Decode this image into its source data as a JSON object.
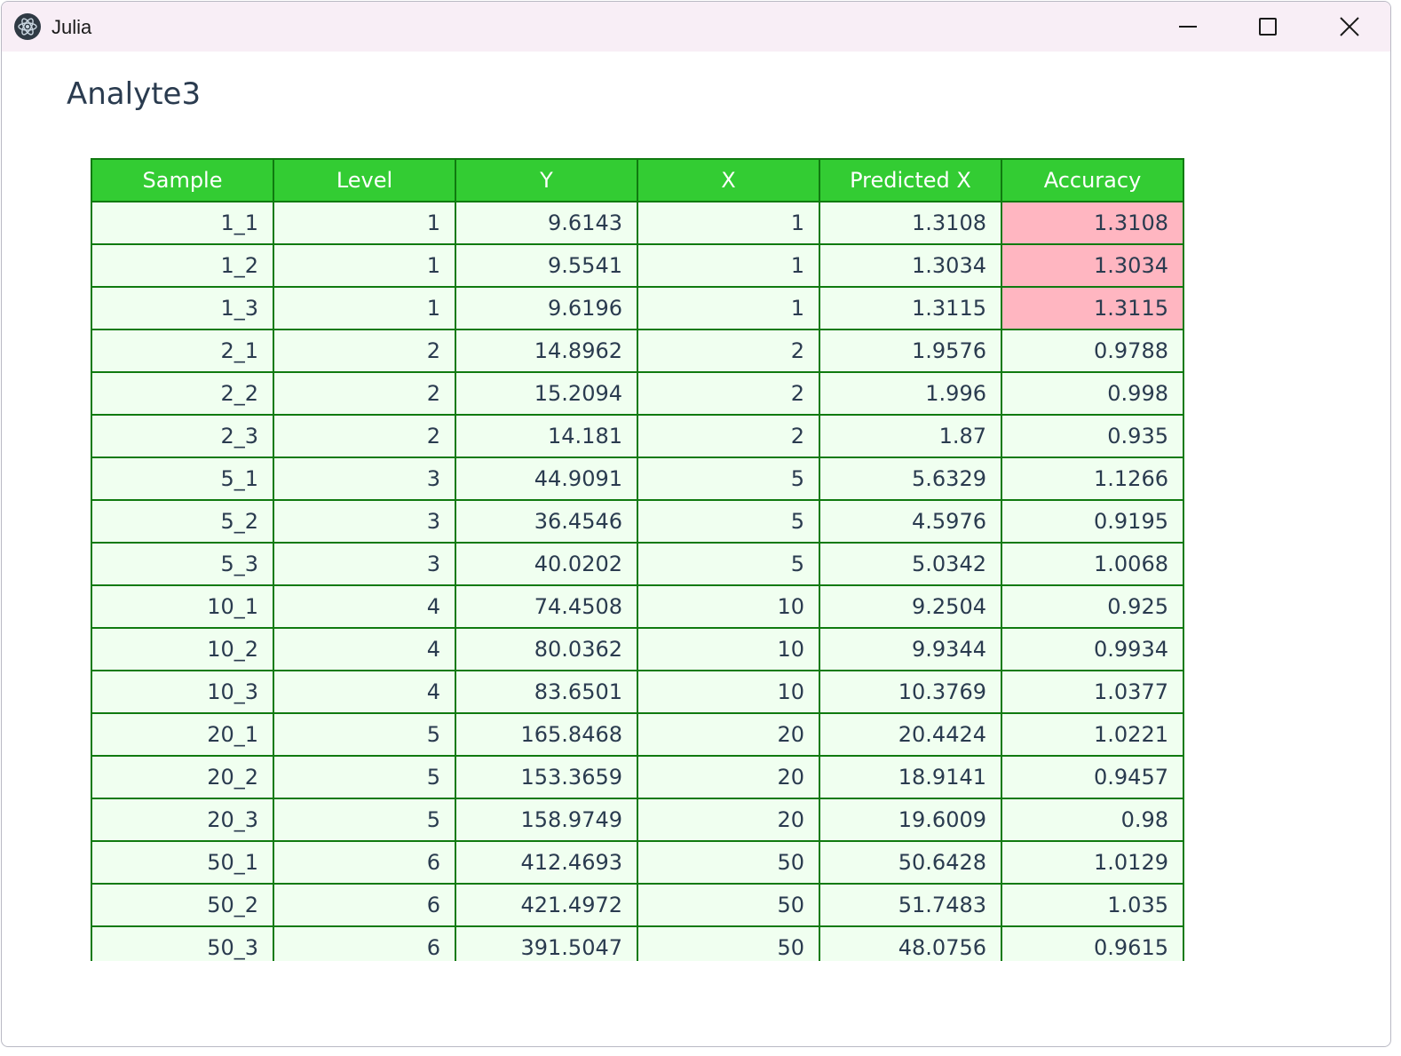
{
  "window": {
    "title": "Julia",
    "icons": {
      "app": "electron-logo-icon",
      "minimize": "minimize-icon",
      "maximize": "maximize-icon",
      "close": "close-icon"
    }
  },
  "page": {
    "heading": "Analyte3"
  },
  "table": {
    "headers": [
      "Sample",
      "Level",
      "Y",
      "X",
      "Predicted X",
      "Accuracy"
    ],
    "highlight_color": "#ffb6c1",
    "header_color": "#33cc33",
    "rows": [
      {
        "cells": [
          "1_1",
          "1",
          "9.6143",
          "1",
          "1.3108",
          "1.3108"
        ],
        "flagged": true
      },
      {
        "cells": [
          "1_2",
          "1",
          "9.5541",
          "1",
          "1.3034",
          "1.3034"
        ],
        "flagged": true
      },
      {
        "cells": [
          "1_3",
          "1",
          "9.6196",
          "1",
          "1.3115",
          "1.3115"
        ],
        "flagged": true
      },
      {
        "cells": [
          "2_1",
          "2",
          "14.8962",
          "2",
          "1.9576",
          "0.9788"
        ],
        "flagged": false
      },
      {
        "cells": [
          "2_2",
          "2",
          "15.2094",
          "2",
          "1.996",
          "0.998"
        ],
        "flagged": false
      },
      {
        "cells": [
          "2_3",
          "2",
          "14.181",
          "2",
          "1.87",
          "0.935"
        ],
        "flagged": false
      },
      {
        "cells": [
          "5_1",
          "3",
          "44.9091",
          "5",
          "5.6329",
          "1.1266"
        ],
        "flagged": false
      },
      {
        "cells": [
          "5_2",
          "3",
          "36.4546",
          "5",
          "4.5976",
          "0.9195"
        ],
        "flagged": false
      },
      {
        "cells": [
          "5_3",
          "3",
          "40.0202",
          "5",
          "5.0342",
          "1.0068"
        ],
        "flagged": false
      },
      {
        "cells": [
          "10_1",
          "4",
          "74.4508",
          "10",
          "9.2504",
          "0.925"
        ],
        "flagged": false
      },
      {
        "cells": [
          "10_2",
          "4",
          "80.0362",
          "10",
          "9.9344",
          "0.9934"
        ],
        "flagged": false
      },
      {
        "cells": [
          "10_3",
          "4",
          "83.6501",
          "10",
          "10.3769",
          "1.0377"
        ],
        "flagged": false
      },
      {
        "cells": [
          "20_1",
          "5",
          "165.8468",
          "20",
          "20.4424",
          "1.0221"
        ],
        "flagged": false
      },
      {
        "cells": [
          "20_2",
          "5",
          "153.3659",
          "20",
          "18.9141",
          "0.9457"
        ],
        "flagged": false
      },
      {
        "cells": [
          "20_3",
          "5",
          "158.9749",
          "20",
          "19.6009",
          "0.98"
        ],
        "flagged": false
      },
      {
        "cells": [
          "50_1",
          "6",
          "412.4693",
          "50",
          "50.6428",
          "1.0129"
        ],
        "flagged": false
      },
      {
        "cells": [
          "50_2",
          "6",
          "421.4972",
          "50",
          "51.7483",
          "1.035"
        ],
        "flagged": false
      },
      {
        "cells": [
          "50_3",
          "6",
          "391.5047",
          "50",
          "48.0756",
          "0.9615"
        ],
        "flagged": false
      }
    ]
  }
}
